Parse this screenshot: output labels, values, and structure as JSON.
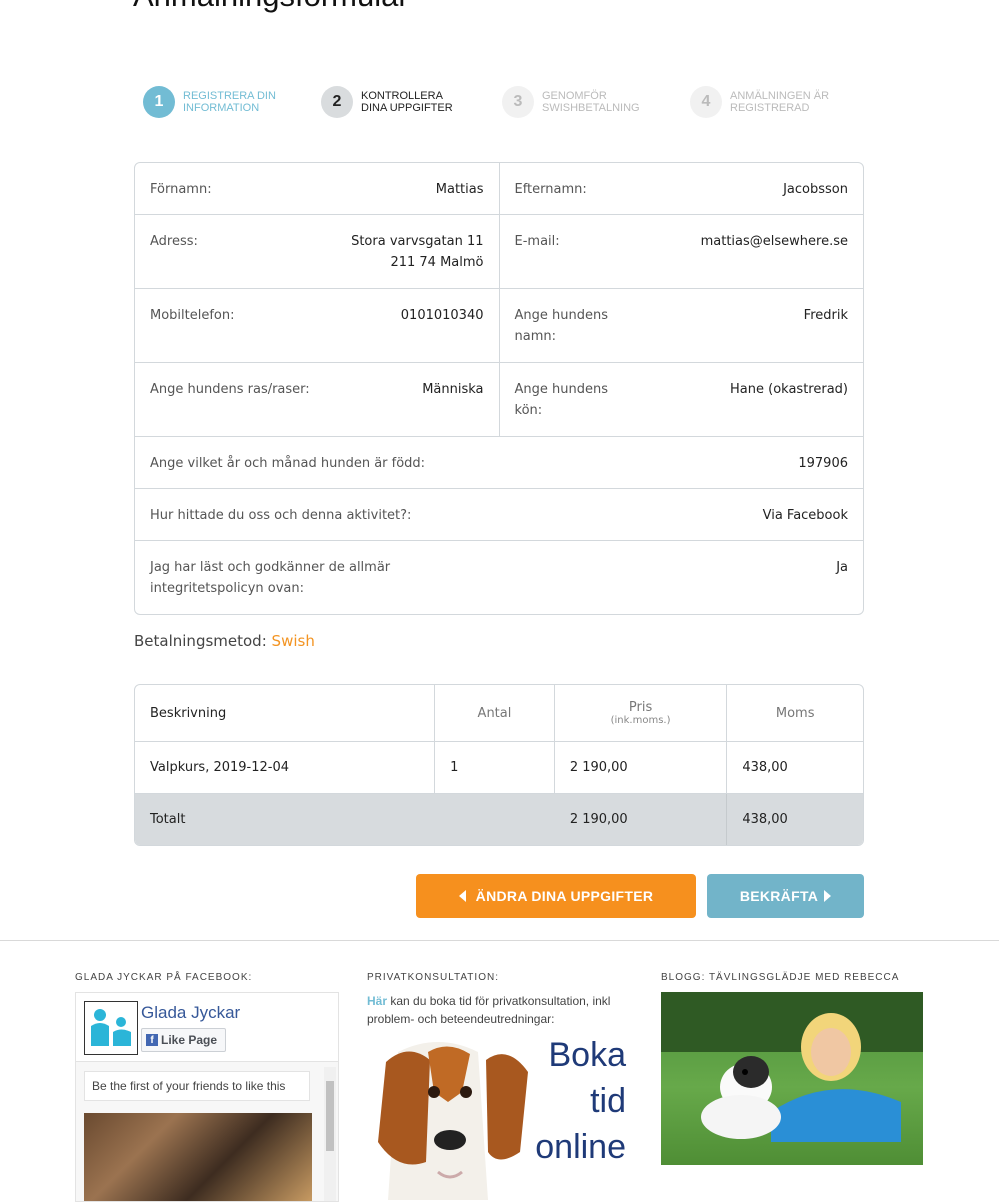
{
  "page": {
    "title": "Anmälningsformulär"
  },
  "steps": [
    {
      "num": "1",
      "label": "REGISTRERA DIN INFORMATION"
    },
    {
      "num": "2",
      "label": "KONTROLLERA DINA UPPGIFTER"
    },
    {
      "num": "3",
      "label": "GENOMFÖR SWISHBETALNING"
    },
    {
      "num": "4",
      "label": "ANMÄLNINGEN ÄR REGISTRERAD"
    }
  ],
  "details": {
    "first_name": {
      "label": "Förnamn:",
      "value": "Mattias"
    },
    "last_name": {
      "label": "Efternamn:",
      "value": "Jacobsson"
    },
    "address": {
      "label": "Adress:",
      "line1": "Stora varvsgatan 11",
      "line2": "211 74 Malmö"
    },
    "email": {
      "label": "E-mail:",
      "value": "mattias@elsewhere.se"
    },
    "mobile": {
      "label": "Mobiltelefon:",
      "value": "0101010340"
    },
    "dog_name": {
      "label": "Ange hundens namn:",
      "value": "Fredrik"
    },
    "dog_breed": {
      "label": "Ange hundens ras/raser:",
      "value": "Människa"
    },
    "dog_gender": {
      "label": "Ange hundens kön:",
      "value": "Hane (okastrerad)"
    },
    "birth": {
      "label": "Ange vilket år och månad hunden är född:",
      "value": "197906"
    },
    "source": {
      "label": "Hur hittade du oss och denna aktivitet?:",
      "value": "Via Facebook"
    },
    "policy": {
      "label": "Jag har läst och godkänner de allmär integritetspolicyn ovan:",
      "value": "Ja"
    }
  },
  "payment": {
    "label": "Betalningsmetod:",
    "method": "Swish"
  },
  "order": {
    "headers": {
      "description": "Beskrivning",
      "quantity": "Antal",
      "price": "Pris",
      "price_sub": "(ink.moms.)",
      "vat": "Moms"
    },
    "items": [
      {
        "description": "Valpkurs,  2019-12-04",
        "quantity": "1",
        "price": "2 190,00",
        "vat": "438,00"
      }
    ],
    "total": {
      "label": "Totalt",
      "price": "2 190,00",
      "vat": "438,00"
    }
  },
  "buttons": {
    "edit": "ÄNDRA DINA UPPGIFTER",
    "confirm": "BEKRÄFTA"
  },
  "footer": {
    "facebook": {
      "title": "GLADA JYCKAR PÅ FACEBOOK:",
      "page_name": "Glada Jyckar",
      "like_label": "Like Page",
      "friends_text": "Be the first of your friends to like this"
    },
    "private": {
      "title": "PRIVATKONSULTATION:",
      "link": "Här",
      "text": " kan du boka tid för privatkonsultation, inkl problem- och beteendeutredningar:",
      "image_lines": [
        "Boka",
        "tid",
        "online"
      ]
    },
    "blog": {
      "title": "BLOGG: TÄVLINGSGLÄDJE MED REBECCA"
    }
  },
  "colors": {
    "accent_blue": "#72bcd4",
    "accent_orange": "#f6901e",
    "total_bg": "#d7dbde"
  }
}
